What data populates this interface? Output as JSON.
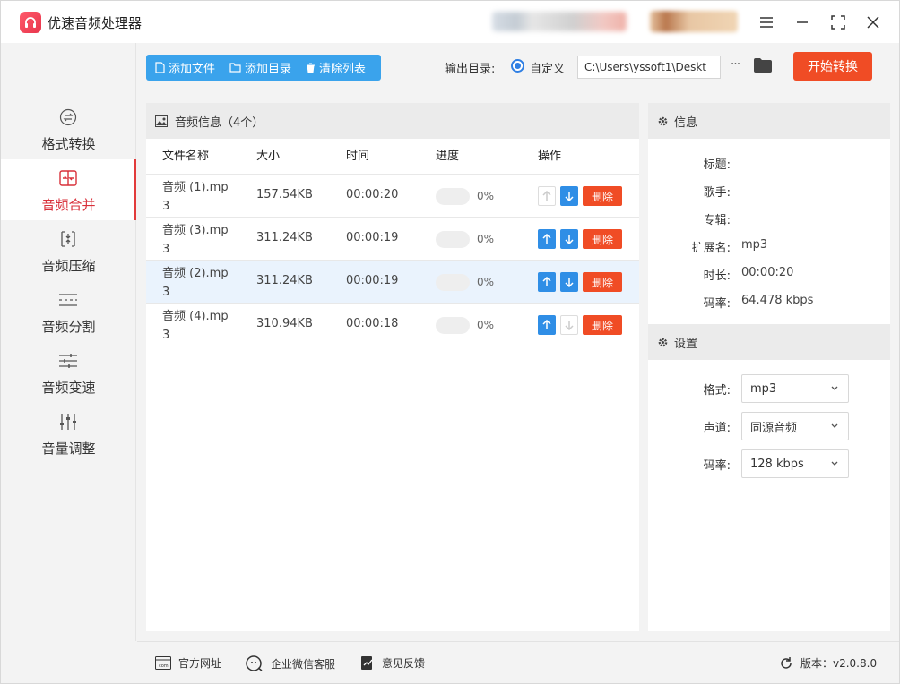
{
  "app": {
    "title": "优速音频处理器"
  },
  "sidebar": {
    "items": [
      {
        "label": "格式转换",
        "icon": "format-convert-icon",
        "active": false
      },
      {
        "label": "音频合并",
        "icon": "merge-icon",
        "active": true
      },
      {
        "label": "音频压缩",
        "icon": "compress-icon",
        "active": false
      },
      {
        "label": "音频分割",
        "icon": "split-icon",
        "active": false
      },
      {
        "label": "音频变速",
        "icon": "speed-icon",
        "active": false
      },
      {
        "label": "音量调整",
        "icon": "volume-icon",
        "active": false
      }
    ]
  },
  "toolbar": {
    "add_file": "添加文件",
    "add_dir": "添加目录",
    "clear_list": "清除列表",
    "output_label": "输出目录:",
    "radio_custom": "自定义",
    "output_path": "C:\\Users\\yssoft1\\Deskt",
    "more": "···",
    "start": "开始转换"
  },
  "list": {
    "title": "音频信息（4个）",
    "columns": {
      "name": "文件名称",
      "size": "大小",
      "time": "时间",
      "progress": "进度",
      "actions": "操作"
    },
    "rows": [
      {
        "name": "音频 (1).mp3",
        "size": "157.54KB",
        "time": "00:00:20",
        "progress": 0,
        "progress_text": "0%",
        "up_enabled": false,
        "down_enabled": true,
        "delete": "删除",
        "selected": false
      },
      {
        "name": "音频 (3).mp3",
        "size": "311.24KB",
        "time": "00:00:19",
        "progress": 0,
        "progress_text": "0%",
        "up_enabled": true,
        "down_enabled": true,
        "delete": "删除",
        "selected": false
      },
      {
        "name": "音频 (2).mp3",
        "size": "311.24KB",
        "time": "00:00:19",
        "progress": 0,
        "progress_text": "0%",
        "up_enabled": true,
        "down_enabled": true,
        "delete": "删除",
        "selected": true
      },
      {
        "name": "音频 (4).mp3",
        "size": "310.94KB",
        "time": "00:00:18",
        "progress": 0,
        "progress_text": "0%",
        "up_enabled": true,
        "down_enabled": false,
        "delete": "删除",
        "selected": false
      }
    ]
  },
  "info": {
    "title": "信息",
    "fields": [
      {
        "key": "标题:",
        "value": ""
      },
      {
        "key": "歌手:",
        "value": ""
      },
      {
        "key": "专辑:",
        "value": ""
      },
      {
        "key": "扩展名:",
        "value": "mp3"
      },
      {
        "key": "时长:",
        "value": "00:00:20"
      },
      {
        "key": "码率:",
        "value": "64.478 kbps"
      }
    ]
  },
  "settings": {
    "title": "设置",
    "format_label": "格式:",
    "format_value": "mp3",
    "channel_label": "声道:",
    "channel_value": "同源音频",
    "bitrate_label": "码率:",
    "bitrate_value": "128 kbps"
  },
  "footer": {
    "website": "官方网址",
    "wechat": "企业微信客服",
    "feedback": "意见反馈",
    "version": "版本：v2.0.8.0"
  },
  "colors": {
    "accent_blue": "#3aa3ec",
    "primary_blue": "#2f8ee6",
    "danger": "#f04c25",
    "active_red": "#d8303a"
  }
}
